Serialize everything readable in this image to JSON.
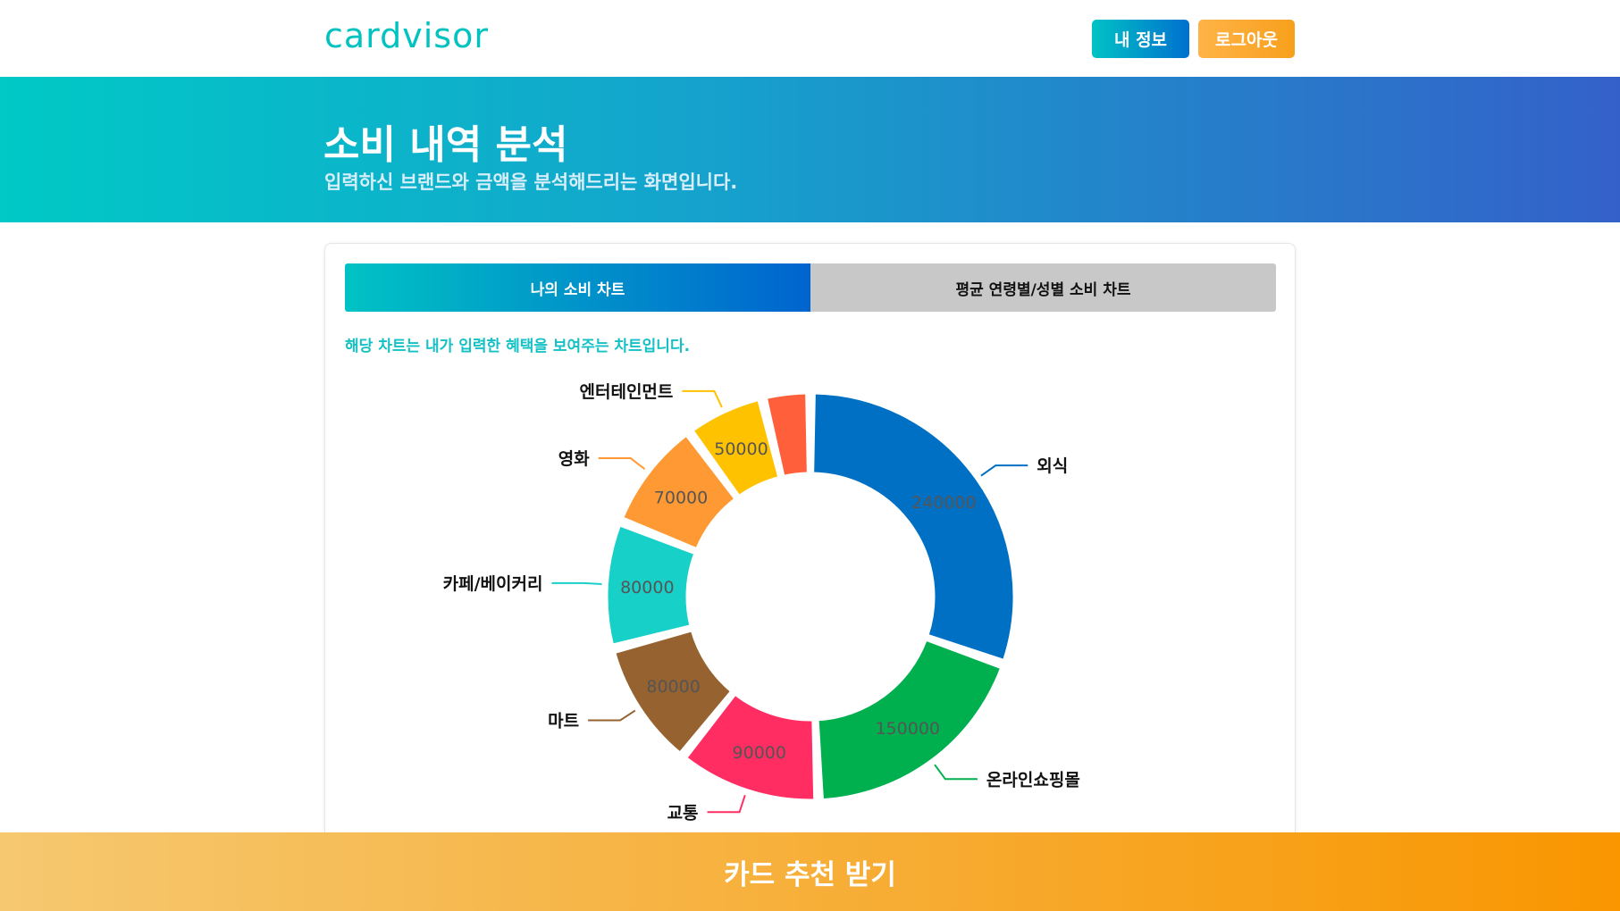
{
  "header": {
    "logo": "cardvisor",
    "my_info_label": "내 정보",
    "logout_label": "로그아웃"
  },
  "hero": {
    "title": "소비 내역 분석",
    "subtitle": "입력하신 브랜드와 금액을 분석해드리는 화면입니다."
  },
  "tabs": [
    {
      "label": "나의 소비 차트",
      "active": true
    },
    {
      "label": "평균 연령별/성별 소비 차트",
      "active": false
    }
  ],
  "note": "해당 차트는 내가 입력한 혜택을 보여주는 차트입니다.",
  "footer": {
    "cta_label": "카드 추천 받기"
  },
  "colors": {
    "accent": "#00c3c4",
    "primary_blue": "#0070cf",
    "orange": "#f7a01c"
  },
  "chart_data": {
    "type": "pie",
    "donut": true,
    "categories": [
      "외식",
      "온라인쇼핑몰",
      "교통",
      "마트",
      "카페/베이커리",
      "영화",
      "엔터테인먼트",
      ""
    ],
    "values": [
      240000,
      150000,
      90000,
      80000,
      80000,
      70000,
      50000,
      30000
    ],
    "value_labels": [
      "240000",
      "150000",
      "90000",
      "80000",
      "80000",
      "70000",
      "50000",
      ""
    ],
    "colors": [
      "#0070c4",
      "#00b04f",
      "#ff2d62",
      "#96622f",
      "#17d0c8",
      "#ff9933",
      "#ffc200",
      "#ff5f3a"
    ],
    "title": "",
    "legend": "none"
  }
}
